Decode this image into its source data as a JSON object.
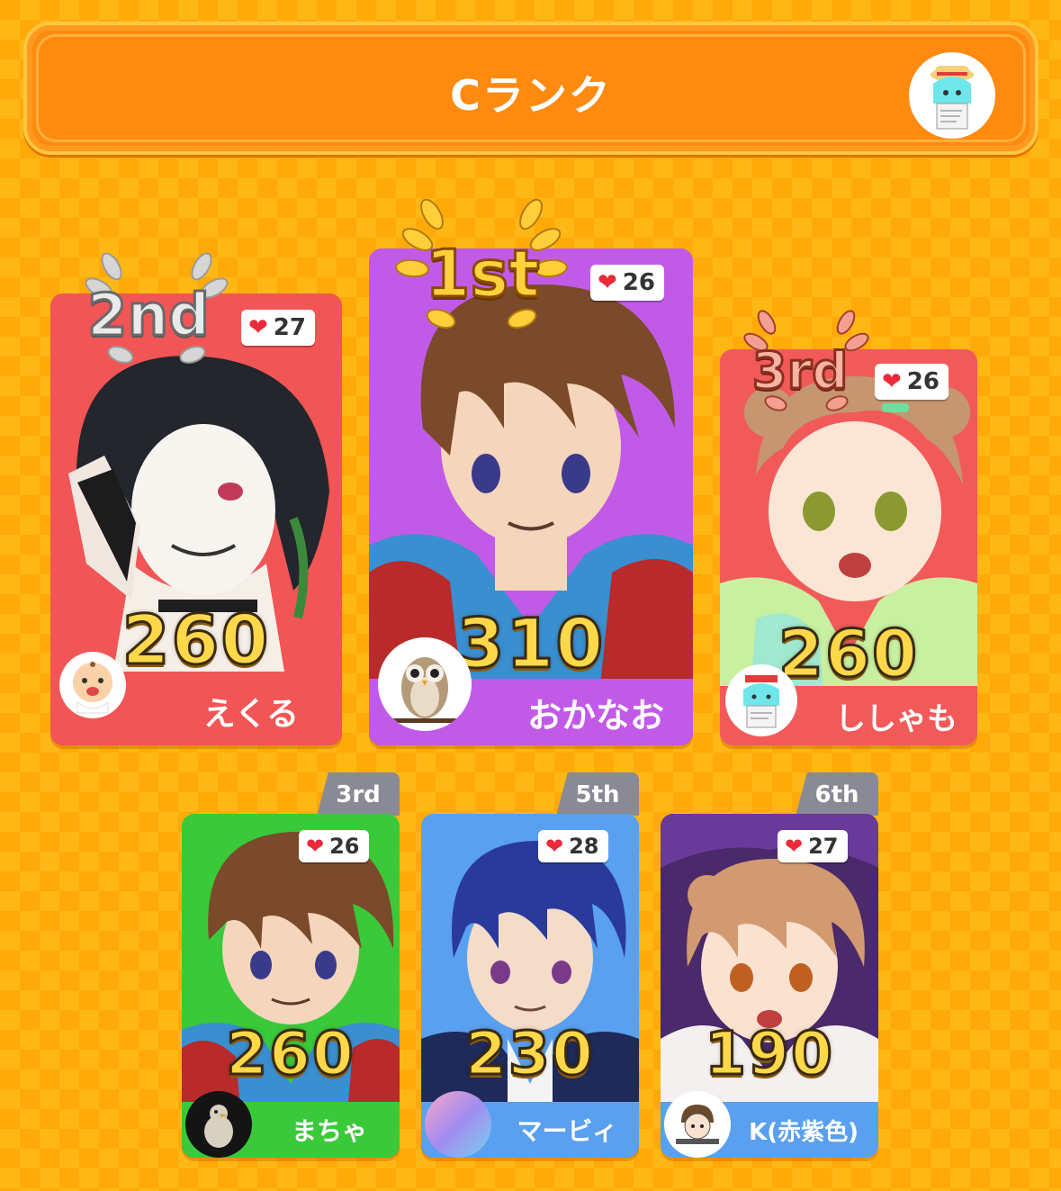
{
  "header": {
    "title": "Cランク",
    "avatar_icon": "user-avatar-icon"
  },
  "podium": [
    {
      "place": "2nd",
      "score": "260",
      "likes": "27",
      "name": "えくる",
      "color": "#f25555",
      "avatar_icon": "baby-face-icon"
    },
    {
      "place": "1st",
      "score": "310",
      "likes": "26",
      "name": "おかなお",
      "color": "#c25ae8",
      "avatar_icon": "owl-icon"
    },
    {
      "place": "3rd",
      "score": "260",
      "likes": "26",
      "name": "ししゃも",
      "color": "#f25a5a",
      "avatar_icon": "character-sketch-icon"
    }
  ],
  "others": [
    {
      "place": "3rd",
      "score": "260",
      "likes": "26",
      "name": "まちゃ",
      "color": "#3ac93a",
      "avatar_icon": "penguin-icon"
    },
    {
      "place": "5th",
      "score": "230",
      "likes": "28",
      "name": "マービィ",
      "color": "#5aa0f0",
      "avatar_icon": "gradient-avatar-icon"
    },
    {
      "place": "6th",
      "score": "190",
      "likes": "27",
      "name": "K(赤紫色)",
      "color": "#5aa0f0",
      "avatar_icon": "doodle-face-icon"
    }
  ]
}
